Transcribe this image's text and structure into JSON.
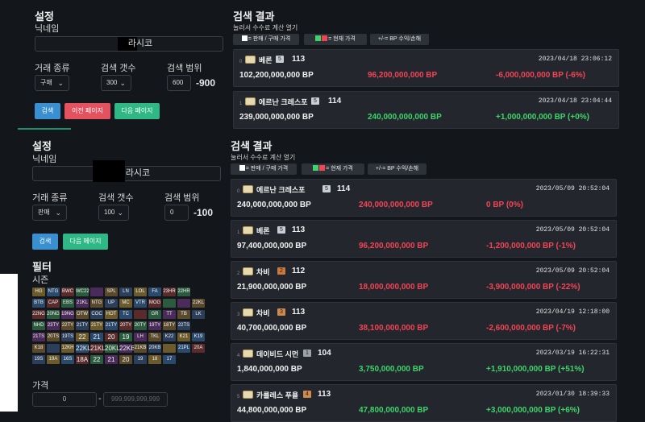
{
  "top": {
    "settings_title": "설정",
    "nickname_label": "닉네임",
    "nickname_value": "라시코",
    "trade_type_label": "거래 종류",
    "trade_type_value": "구매",
    "count_label": "검색 갯수",
    "count_value": "300",
    "range_label": "검색 범위",
    "range_value": "600",
    "range_display": "-900",
    "search_btn": "검색",
    "prev_btn": "이전 페이지",
    "next_btn": "다음 페이지",
    "results_title": "검색 결과",
    "calc_label": "눌러서 수수료 계산 열기",
    "chip_trade": "= 판매 / 구매 가격",
    "chip_current": "= 현재 가격",
    "chip_profit": "+/-= BP 수익/손해",
    "cards": [
      {
        "idx": "0",
        "name": "베론",
        "grade": "5",
        "ovr": "113",
        "date": "2023/04/18 23:06:12",
        "price": "102,200,000,000 BP",
        "current": "96,200,000,000 BP",
        "profit": "-6,000,000,000 BP (-6%)"
      },
      {
        "idx": "1",
        "name": "에르난 크레스포",
        "grade": "5",
        "ovr": "114",
        "date": "2023/04/18 23:04:44",
        "price": "239,000,000,000 BP",
        "current": "240,000,000,000 BP",
        "profit": "+1,000,000,000 BP (+0%)"
      }
    ]
  },
  "bottom": {
    "settings_title": "설정",
    "nickname_label": "닉네임",
    "nickname_value": "라시코",
    "trade_type_label": "거래 종류",
    "trade_type_value": "판매",
    "count_label": "검색 갯수",
    "count_value": "100",
    "range_label": "검색 범위",
    "range_value": "0",
    "range_display": "-100",
    "search_btn": "검색",
    "next_btn": "다음 페이지",
    "filter_title": "필터",
    "season_label": "시즌",
    "price_label": "가격",
    "price_min": "0",
    "price_sep": "-",
    "price_max_placeholder": "999,999,999,999",
    "results_title": "검색 결과",
    "calc_label": "눌러서 수수료 계산 열기",
    "chip_trade": "= 판매 / 구매 가격",
    "chip_current": "= 현재 가격",
    "chip_profit": "+/-= BP 수익/손해",
    "seasons": [
      [
        "HG",
        "NTG",
        "BWC",
        "WC22",
        "",
        "SPL",
        "LN",
        "LOL",
        "FA",
        "23HR",
        "22HR"
      ],
      [
        "BTB",
        "CAP",
        "EBS",
        "21KL",
        "NTG",
        "UP",
        "MC",
        "VTR",
        "MOG",
        "",
        "",
        "22KL"
      ],
      [
        "22NG",
        "20NG",
        "19NG",
        "OTW",
        "COC",
        "HOT",
        "TC",
        "",
        "GR",
        "TT",
        "TB",
        "LK"
      ],
      [
        "NHD",
        "23TY",
        "22TY",
        "21TY",
        "21TY",
        "21TY",
        "20TY",
        "20TY",
        "19TY",
        "18TY",
        "22TS"
      ],
      [
        "21TS",
        "20TS",
        "19TS",
        "22",
        "21",
        "20",
        "19",
        "LH",
        "TKL",
        "K22",
        "K21",
        "K19"
      ],
      [
        "K18",
        "",
        "12KH",
        "22KL",
        "21KL",
        "20KL",
        "22KB",
        "21KB",
        "20KB",
        "",
        "21PL",
        "20A"
      ],
      [
        "19S",
        "19A",
        "16S",
        "18A",
        "22",
        "21",
        "20",
        "19",
        "18",
        "17"
      ]
    ],
    "cards": [
      {
        "idx": "0",
        "name": "에르난 크레스포",
        "grade": "5",
        "ovr": "114",
        "date": "2023/05/09 20:52:04",
        "price": "240,000,000,000 BP",
        "current": "240,000,000,000 BP",
        "profit": "0 BP (0%)"
      },
      {
        "idx": "1",
        "name": "베론",
        "grade": "5",
        "ovr": "113",
        "date": "2023/05/09 20:52:04",
        "price": "97,400,000,000 BP",
        "current": "96,200,000,000 BP",
        "profit": "-1,200,000,000 BP (-1%)"
      },
      {
        "idx": "2",
        "name": "차비",
        "grade": "2",
        "ovr": "112",
        "date": "2023/05/09 20:52:04",
        "price": "21,900,000,000 BP",
        "current": "18,000,000,000 BP",
        "profit": "-3,900,000,000 BP (-22%)"
      },
      {
        "idx": "3",
        "name": "차비",
        "grade": "3",
        "ovr": "113",
        "date": "2023/04/19 12:18:00",
        "price": "40,700,000,000 BP",
        "current": "38,100,000,000 BP",
        "profit": "-2,600,000,000 BP (-7%)"
      },
      {
        "idx": "4",
        "name": "데이비드 시먼",
        "grade": "1",
        "ovr": "104",
        "date": "2023/03/19 16:22:31",
        "price": "1,840,000,000 BP",
        "current": "3,750,000,000 BP",
        "profit": "+1,910,000,000 BP (+51%)"
      },
      {
        "idx": "5",
        "name": "카를레스 푸욜",
        "grade": "4",
        "ovr": "113",
        "date": "2023/01/30 18:39:33",
        "price": "44,800,000,000 BP",
        "current": "47,800,000,000 BP",
        "profit": "+3,000,000,000 BP (+6%)"
      }
    ]
  },
  "colors": {
    "bg": "#13171c",
    "card": "#23272d",
    "blue": "#3a8fd0",
    "red": "#e3525e",
    "green": "#2fb786",
    "loss": "#f24455",
    "gain": "#3fd46a",
    "current": "#f24455"
  }
}
